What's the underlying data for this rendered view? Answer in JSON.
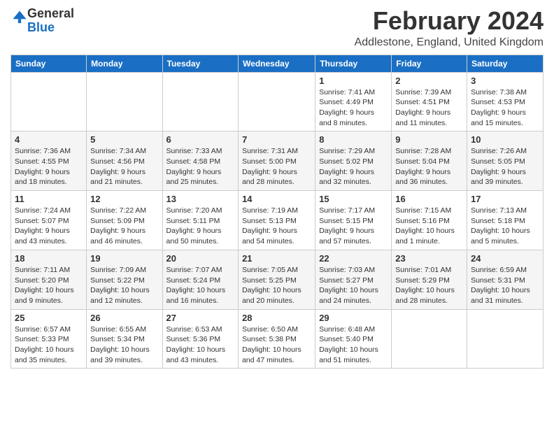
{
  "logo": {
    "general": "General",
    "blue": "Blue"
  },
  "header": {
    "title": "February 2024",
    "subtitle": "Addlestone, England, United Kingdom"
  },
  "weekdays": [
    "Sunday",
    "Monday",
    "Tuesday",
    "Wednesday",
    "Thursday",
    "Friday",
    "Saturday"
  ],
  "weeks": [
    [
      {
        "day": "",
        "info": ""
      },
      {
        "day": "",
        "info": ""
      },
      {
        "day": "",
        "info": ""
      },
      {
        "day": "",
        "info": ""
      },
      {
        "day": "1",
        "info": "Sunrise: 7:41 AM\nSunset: 4:49 PM\nDaylight: 9 hours\nand 8 minutes."
      },
      {
        "day": "2",
        "info": "Sunrise: 7:39 AM\nSunset: 4:51 PM\nDaylight: 9 hours\nand 11 minutes."
      },
      {
        "day": "3",
        "info": "Sunrise: 7:38 AM\nSunset: 4:53 PM\nDaylight: 9 hours\nand 15 minutes."
      }
    ],
    [
      {
        "day": "4",
        "info": "Sunrise: 7:36 AM\nSunset: 4:55 PM\nDaylight: 9 hours\nand 18 minutes."
      },
      {
        "day": "5",
        "info": "Sunrise: 7:34 AM\nSunset: 4:56 PM\nDaylight: 9 hours\nand 21 minutes."
      },
      {
        "day": "6",
        "info": "Sunrise: 7:33 AM\nSunset: 4:58 PM\nDaylight: 9 hours\nand 25 minutes."
      },
      {
        "day": "7",
        "info": "Sunrise: 7:31 AM\nSunset: 5:00 PM\nDaylight: 9 hours\nand 28 minutes."
      },
      {
        "day": "8",
        "info": "Sunrise: 7:29 AM\nSunset: 5:02 PM\nDaylight: 9 hours\nand 32 minutes."
      },
      {
        "day": "9",
        "info": "Sunrise: 7:28 AM\nSunset: 5:04 PM\nDaylight: 9 hours\nand 36 minutes."
      },
      {
        "day": "10",
        "info": "Sunrise: 7:26 AM\nSunset: 5:05 PM\nDaylight: 9 hours\nand 39 minutes."
      }
    ],
    [
      {
        "day": "11",
        "info": "Sunrise: 7:24 AM\nSunset: 5:07 PM\nDaylight: 9 hours\nand 43 minutes."
      },
      {
        "day": "12",
        "info": "Sunrise: 7:22 AM\nSunset: 5:09 PM\nDaylight: 9 hours\nand 46 minutes."
      },
      {
        "day": "13",
        "info": "Sunrise: 7:20 AM\nSunset: 5:11 PM\nDaylight: 9 hours\nand 50 minutes."
      },
      {
        "day": "14",
        "info": "Sunrise: 7:19 AM\nSunset: 5:13 PM\nDaylight: 9 hours\nand 54 minutes."
      },
      {
        "day": "15",
        "info": "Sunrise: 7:17 AM\nSunset: 5:15 PM\nDaylight: 9 hours\nand 57 minutes."
      },
      {
        "day": "16",
        "info": "Sunrise: 7:15 AM\nSunset: 5:16 PM\nDaylight: 10 hours\nand 1 minute."
      },
      {
        "day": "17",
        "info": "Sunrise: 7:13 AM\nSunset: 5:18 PM\nDaylight: 10 hours\nand 5 minutes."
      }
    ],
    [
      {
        "day": "18",
        "info": "Sunrise: 7:11 AM\nSunset: 5:20 PM\nDaylight: 10 hours\nand 9 minutes."
      },
      {
        "day": "19",
        "info": "Sunrise: 7:09 AM\nSunset: 5:22 PM\nDaylight: 10 hours\nand 12 minutes."
      },
      {
        "day": "20",
        "info": "Sunrise: 7:07 AM\nSunset: 5:24 PM\nDaylight: 10 hours\nand 16 minutes."
      },
      {
        "day": "21",
        "info": "Sunrise: 7:05 AM\nSunset: 5:25 PM\nDaylight: 10 hours\nand 20 minutes."
      },
      {
        "day": "22",
        "info": "Sunrise: 7:03 AM\nSunset: 5:27 PM\nDaylight: 10 hours\nand 24 minutes."
      },
      {
        "day": "23",
        "info": "Sunrise: 7:01 AM\nSunset: 5:29 PM\nDaylight: 10 hours\nand 28 minutes."
      },
      {
        "day": "24",
        "info": "Sunrise: 6:59 AM\nSunset: 5:31 PM\nDaylight: 10 hours\nand 31 minutes."
      }
    ],
    [
      {
        "day": "25",
        "info": "Sunrise: 6:57 AM\nSunset: 5:33 PM\nDaylight: 10 hours\nand 35 minutes."
      },
      {
        "day": "26",
        "info": "Sunrise: 6:55 AM\nSunset: 5:34 PM\nDaylight: 10 hours\nand 39 minutes."
      },
      {
        "day": "27",
        "info": "Sunrise: 6:53 AM\nSunset: 5:36 PM\nDaylight: 10 hours\nand 43 minutes."
      },
      {
        "day": "28",
        "info": "Sunrise: 6:50 AM\nSunset: 5:38 PM\nDaylight: 10 hours\nand 47 minutes."
      },
      {
        "day": "29",
        "info": "Sunrise: 6:48 AM\nSunset: 5:40 PM\nDaylight: 10 hours\nand 51 minutes."
      },
      {
        "day": "",
        "info": ""
      },
      {
        "day": "",
        "info": ""
      }
    ]
  ]
}
